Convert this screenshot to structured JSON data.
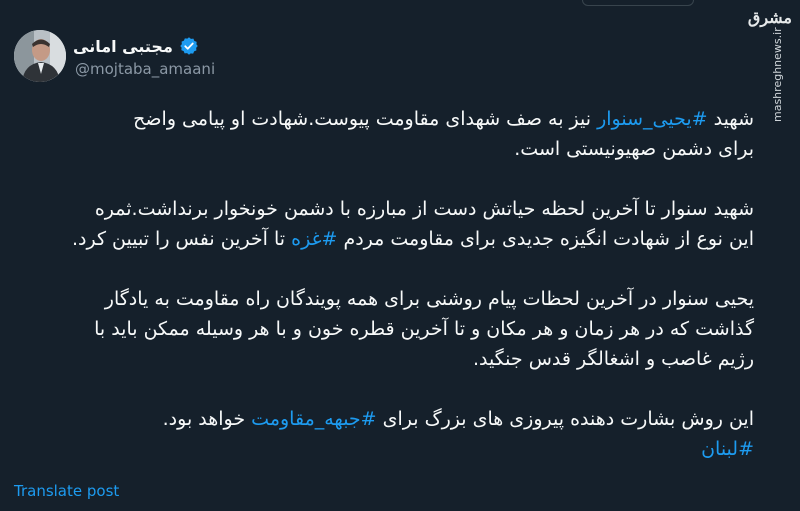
{
  "author": {
    "display_name": "مجتبی امانی",
    "handle": "@mojtaba_amaani",
    "verified": true,
    "avatar": "profile-photo"
  },
  "watermark": {
    "logo": "مشرق",
    "site": "mashreghnews.ir"
  },
  "tweet": {
    "paragraphs": [
      {
        "lines": [
          [
            {
              "text": "شهید ",
              "hashtag": false
            },
            {
              "text": "#یحیی_سنوار",
              "hashtag": true
            },
            {
              "text": " نیز به صف شهدای مقاومت پیوست.شهادت او پیامی واضح",
              "hashtag": false
            }
          ],
          [
            {
              "text": "برای دشمن صهیونیستی است.",
              "hashtag": false
            }
          ]
        ]
      },
      {
        "lines": [
          [
            {
              "text": "شهید سنوار تا آخرین لحظه حیاتش دست از مبارزه با دشمن خونخوار برنداشت.ثمره",
              "hashtag": false
            }
          ],
          [
            {
              "text": "این نوع از شهادت انگیزه جدیدی برای مقاومت مردم ",
              "hashtag": false
            },
            {
              "text": "#غزه",
              "hashtag": true
            },
            {
              "text": " تا آخرین نفس را تبیین کرد.",
              "hashtag": false
            }
          ]
        ]
      },
      {
        "lines": [
          [
            {
              "text": "یحیی سنوار در آخرین لحظات پیام روشنی برای همه پویندگان راه مقاومت به یادگار",
              "hashtag": false
            }
          ],
          [
            {
              "text": "گذاشت که در هر زمان و هر مکان و تا آخرین قطره خون و با هر وسیله ممکن باید با",
              "hashtag": false
            }
          ],
          [
            {
              "text": "رژیم غاصب و اشغالگر قدس جنگید.",
              "hashtag": false
            }
          ]
        ]
      },
      {
        "lines": [
          [
            {
              "text": "این روش بشارت دهنده پیروزی های بزرگ برای ",
              "hashtag": false
            },
            {
              "text": "#جبهه_مقاومت",
              "hashtag": true
            },
            {
              "text": " خواهد بود.",
              "hashtag": false
            }
          ],
          [
            {
              "text": "#لبنان",
              "hashtag": true
            }
          ]
        ]
      }
    ]
  },
  "actions": {
    "translate_label": "Translate post"
  },
  "colors": {
    "background": "#15202b",
    "text": "#f7f9f9",
    "secondary_text": "#8b98a5",
    "link": "#1d9bf0",
    "verified_badge": "#1d9bf0"
  }
}
